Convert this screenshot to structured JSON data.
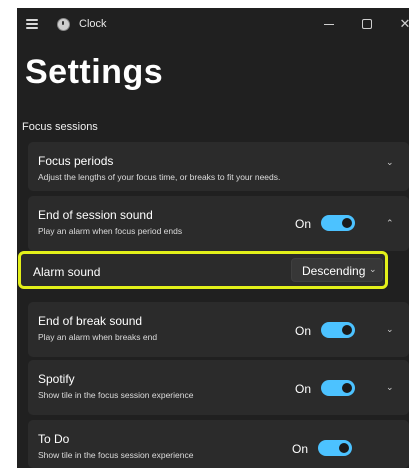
{
  "titlebar": {
    "app_title": "Clock",
    "icons": [
      "hamburger-icon",
      "clock-app-icon",
      "minimize-icon",
      "maximize-icon",
      "close-icon"
    ],
    "close_glyph": "✕"
  },
  "page": {
    "title": "Settings",
    "section": "Focus sessions"
  },
  "settings": {
    "focus_periods": {
      "title": "Focus periods",
      "description": "Adjust the lengths of your focus time, or breaks to fit your needs.",
      "chevron": "⌄"
    },
    "end_session_sound": {
      "title": "End of session sound",
      "description": "Play an alarm when focus period ends",
      "toggle_label": "On",
      "toggle_on": true,
      "chevron": "⌃"
    },
    "alarm_sound": {
      "title": "Alarm sound",
      "value": "Descending",
      "chevron": "⌄",
      "highlight_color": "#e3f01a"
    },
    "end_break_sound": {
      "title": "End of break sound",
      "description": "Play an alarm when breaks end",
      "toggle_label": "On",
      "toggle_on": true,
      "chevron": "⌄"
    },
    "spotify": {
      "title": "Spotify",
      "description": "Show tile in the focus session experience",
      "toggle_label": "On",
      "toggle_on": true,
      "chevron": "⌄"
    },
    "todo": {
      "title": "To Do",
      "description": "Show tile in the focus session experience",
      "toggle_label": "On",
      "toggle_on": true
    }
  },
  "colors": {
    "background": "#202020",
    "card": "#2b2b2b",
    "accent": "#4cc2ff"
  }
}
